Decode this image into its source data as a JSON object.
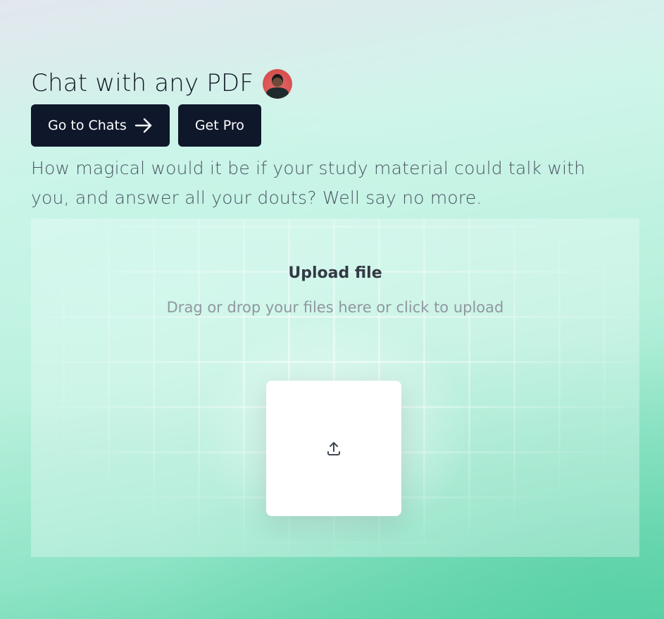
{
  "header": {
    "title": "Chat with any PDF",
    "avatar_alt": "user avatar"
  },
  "actions": {
    "go_to_chats_label": "Go to Chats",
    "get_pro_label": "Get Pro"
  },
  "intro": {
    "subtitle": "How magical would it be if your study material could talk with you, and answer all your douts? Well say no more."
  },
  "upload": {
    "title": "Upload file",
    "hint": "Drag or drop your files here or click to upload",
    "icon": "upload-icon"
  },
  "colors": {
    "button_bg": "#0f172a",
    "button_text": "#ffffff",
    "title_text": "#111827",
    "subtitle_text": "#4b5563",
    "accent_green": "#5fd3a9"
  }
}
